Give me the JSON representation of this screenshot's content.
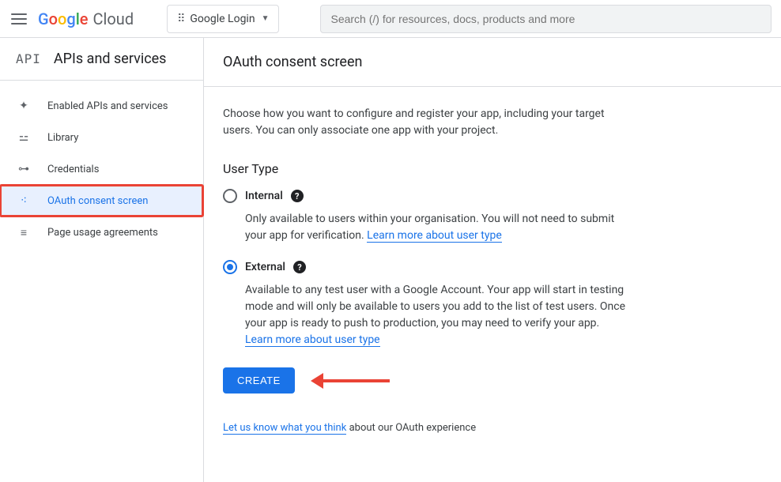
{
  "header": {
    "logo_cloud": "Cloud",
    "project_name": "Google Login",
    "search_placeholder": "Search (/) for resources, docs, products and more"
  },
  "sidebar": {
    "api_icon": "API",
    "title": "APIs and services",
    "items": [
      {
        "label": "Enabled APIs and services"
      },
      {
        "label": "Library"
      },
      {
        "label": "Credentials"
      },
      {
        "label": "OAuth consent screen"
      },
      {
        "label": "Page usage agreements"
      }
    ]
  },
  "main": {
    "title": "OAuth consent screen",
    "intro": "Choose how you want to configure and register your app, including your target users. You can only associate one app with your project.",
    "user_type_heading": "User Type",
    "internal": {
      "label": "Internal",
      "desc": "Only available to users within your organisation. You will not need to submit your app for verification. ",
      "link": "Learn more about user type"
    },
    "external": {
      "label": "External",
      "desc": "Available to any test user with a Google Account. Your app will start in testing mode and will only be available to users you add to the list of test users. Once your app is ready to push to production, you may need to verify your app. ",
      "link": "Learn more about user type"
    },
    "create_button": "CREATE",
    "feedback_link": "Let us know what you think",
    "feedback_rest": " about our OAuth experience"
  }
}
